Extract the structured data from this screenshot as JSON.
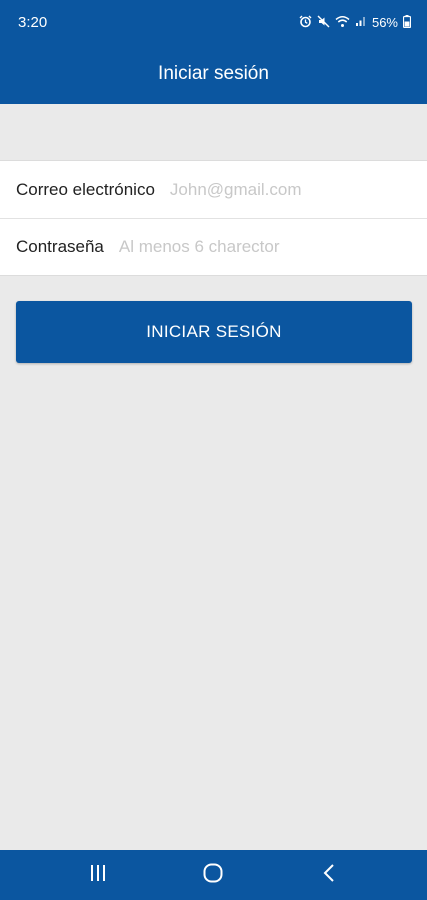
{
  "status_bar": {
    "time": "3:20",
    "battery": "56%",
    "icons": [
      "alarm-icon",
      "mute-icon",
      "wifi-icon",
      "signal-icon",
      "battery-icon"
    ]
  },
  "app_bar": {
    "title": "Iniciar sesión"
  },
  "form": {
    "email_label": "Correo electrónico",
    "email_placeholder": "John@gmail.com",
    "email_value": "",
    "password_label": "Contraseña",
    "password_placeholder": "Al menos 6 charector",
    "password_value": ""
  },
  "login_button_label": "INICIAR SESIÓN",
  "nav_bar": {
    "icons": [
      "recent-apps-icon",
      "home-icon",
      "back-icon"
    ]
  },
  "colors": {
    "primary": "#0b56a0",
    "background": "#eaeaea",
    "placeholder": "#c8c8c8"
  }
}
